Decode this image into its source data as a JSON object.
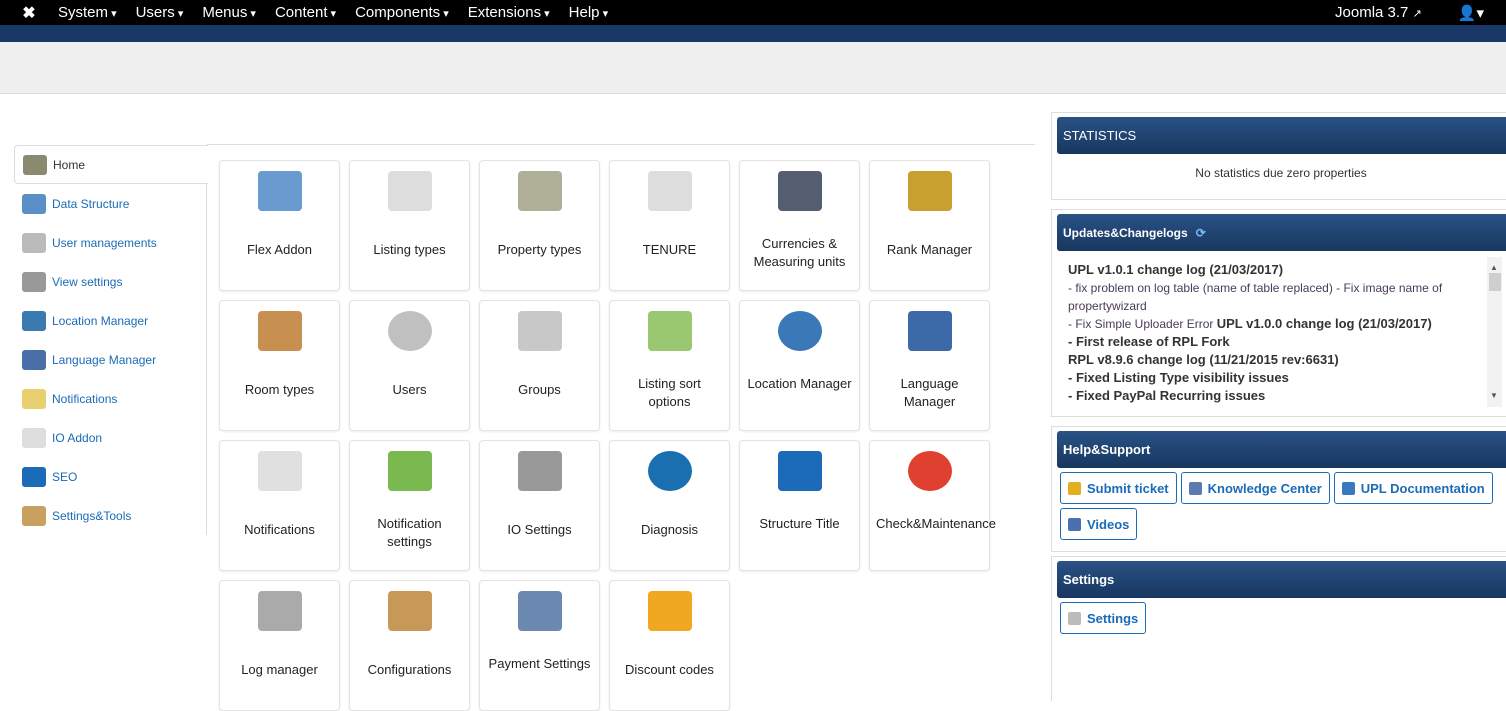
{
  "topbar": {
    "menus": [
      "System",
      "Users",
      "Menus",
      "Content",
      "Components",
      "Extensions",
      "Help"
    ],
    "version": "Joomla 3.7",
    "icons": {
      "logo": "joomla-logo",
      "external": "external-link-icon",
      "user": "user-icon"
    }
  },
  "sidebar": {
    "items": [
      {
        "label": "Home",
        "icon": "home-folder",
        "color": "#8a8a70"
      },
      {
        "label": "Data Structure",
        "icon": "binders",
        "color": "#5a90c8"
      },
      {
        "label": "User managements",
        "icon": "user",
        "color": "#bbbbbb"
      },
      {
        "label": "View settings",
        "icon": "view",
        "color": "#999999"
      },
      {
        "label": "Location Manager",
        "icon": "globe",
        "color": "#3b7ab0"
      },
      {
        "label": "Language Manager",
        "icon": "flag",
        "color": "#4a6fa8"
      },
      {
        "label": "Notifications",
        "icon": "envelope",
        "color": "#e8d070"
      },
      {
        "label": "IO Addon",
        "icon": "shuffle",
        "color": "#dddddd"
      },
      {
        "label": "SEO",
        "icon": "seo",
        "color": "#1b6bb8"
      },
      {
        "label": "Settings&Tools",
        "icon": "tools",
        "color": "#c8a060"
      }
    ]
  },
  "tiles": [
    {
      "label": "Flex Addon",
      "icon": "binders",
      "color": "#6a9bd0"
    },
    {
      "label": "Listing types",
      "icon": "documents",
      "color": "#dddddd"
    },
    {
      "label": "Property types",
      "icon": "folder",
      "color": "#b0b098"
    },
    {
      "label": "TENURE",
      "icon": "documents",
      "color": "#dddddd"
    },
    {
      "label": "Currencies & Measuring units",
      "icon": "font-measure",
      "color": "#555e70"
    },
    {
      "label": "Rank Manager",
      "icon": "money-chart",
      "color": "#c8a030"
    },
    {
      "label": "Room types",
      "icon": "clipboard",
      "color": "#c89050"
    },
    {
      "label": "Users",
      "icon": "user",
      "color": "#c0c0c0"
    },
    {
      "label": "Groups",
      "icon": "users",
      "color": "#c8c8c8"
    },
    {
      "label": "Listing sort options",
      "icon": "sort-list",
      "color": "#9ac870"
    },
    {
      "label": "Location Manager",
      "icon": "globe",
      "color": "#3a78b8"
    },
    {
      "label": "Language Manager",
      "icon": "flag",
      "color": "#3c6aa8"
    },
    {
      "label": "Notifications",
      "icon": "envelope",
      "color": "#e0e0e0"
    },
    {
      "label": "Notification settings",
      "icon": "envelope-arrow",
      "color": "#7ab850"
    },
    {
      "label": "IO Settings",
      "icon": "shuffle",
      "color": "#999999"
    },
    {
      "label": "Diagnosis",
      "icon": "pie-chart",
      "color": "#1a6fb0"
    },
    {
      "label": "Structure Title",
      "icon": "www",
      "color": "#1b6bb8"
    },
    {
      "label": "Check&Maintenance",
      "icon": "lifebuoy",
      "color": "#e04030"
    },
    {
      "label": "Log manager",
      "icon": "log-search",
      "color": "#aaaaaa"
    },
    {
      "label": "Configurations",
      "icon": "toolbox",
      "color": "#c89858"
    },
    {
      "label": "Payment Settings",
      "icon": "credit-card",
      "color": "#6a88b0"
    },
    {
      "label": "Discount codes",
      "icon": "shopping-bag",
      "color": "#f0a820"
    }
  ],
  "statistics": {
    "title": "STATISTICS",
    "message": "No statistics due zero properties"
  },
  "updates": {
    "title": "Updates&Changelogs",
    "refresh_icon": "refresh-icon",
    "log": [
      {
        "bold": "UPL v1.0.1 change log (21/03/2017)"
      },
      {
        "normal": "- fix problem on log table (name of table replaced) - Fix image name of propertywizard"
      },
      {
        "normal": "- Fix Simple Uploader Error ",
        "bold": "UPL v1.0.0 change log (21/03/2017)"
      },
      {
        "bold": "- First release of RPL Fork"
      },
      {
        "bold": "RPL v8.9.6 change log (11/21/2015 rev:6631)"
      },
      {
        "bold": "- Fixed Listing Type visibility issues"
      },
      {
        "bold": "- Fixed PayPal Recurring issues"
      }
    ]
  },
  "help": {
    "title": "Help&Support",
    "buttons": [
      {
        "label": "Submit ticket",
        "color": "#e0b020"
      },
      {
        "label": "Knowledge Center",
        "color": "#5a7ab0"
      },
      {
        "label": "UPL Documentation",
        "color": "#3a78c0"
      },
      {
        "label": "Videos",
        "color": "#4a70b0"
      }
    ]
  },
  "settings": {
    "title": "Settings",
    "button": "Settings",
    "color": "#bbbbbb"
  }
}
